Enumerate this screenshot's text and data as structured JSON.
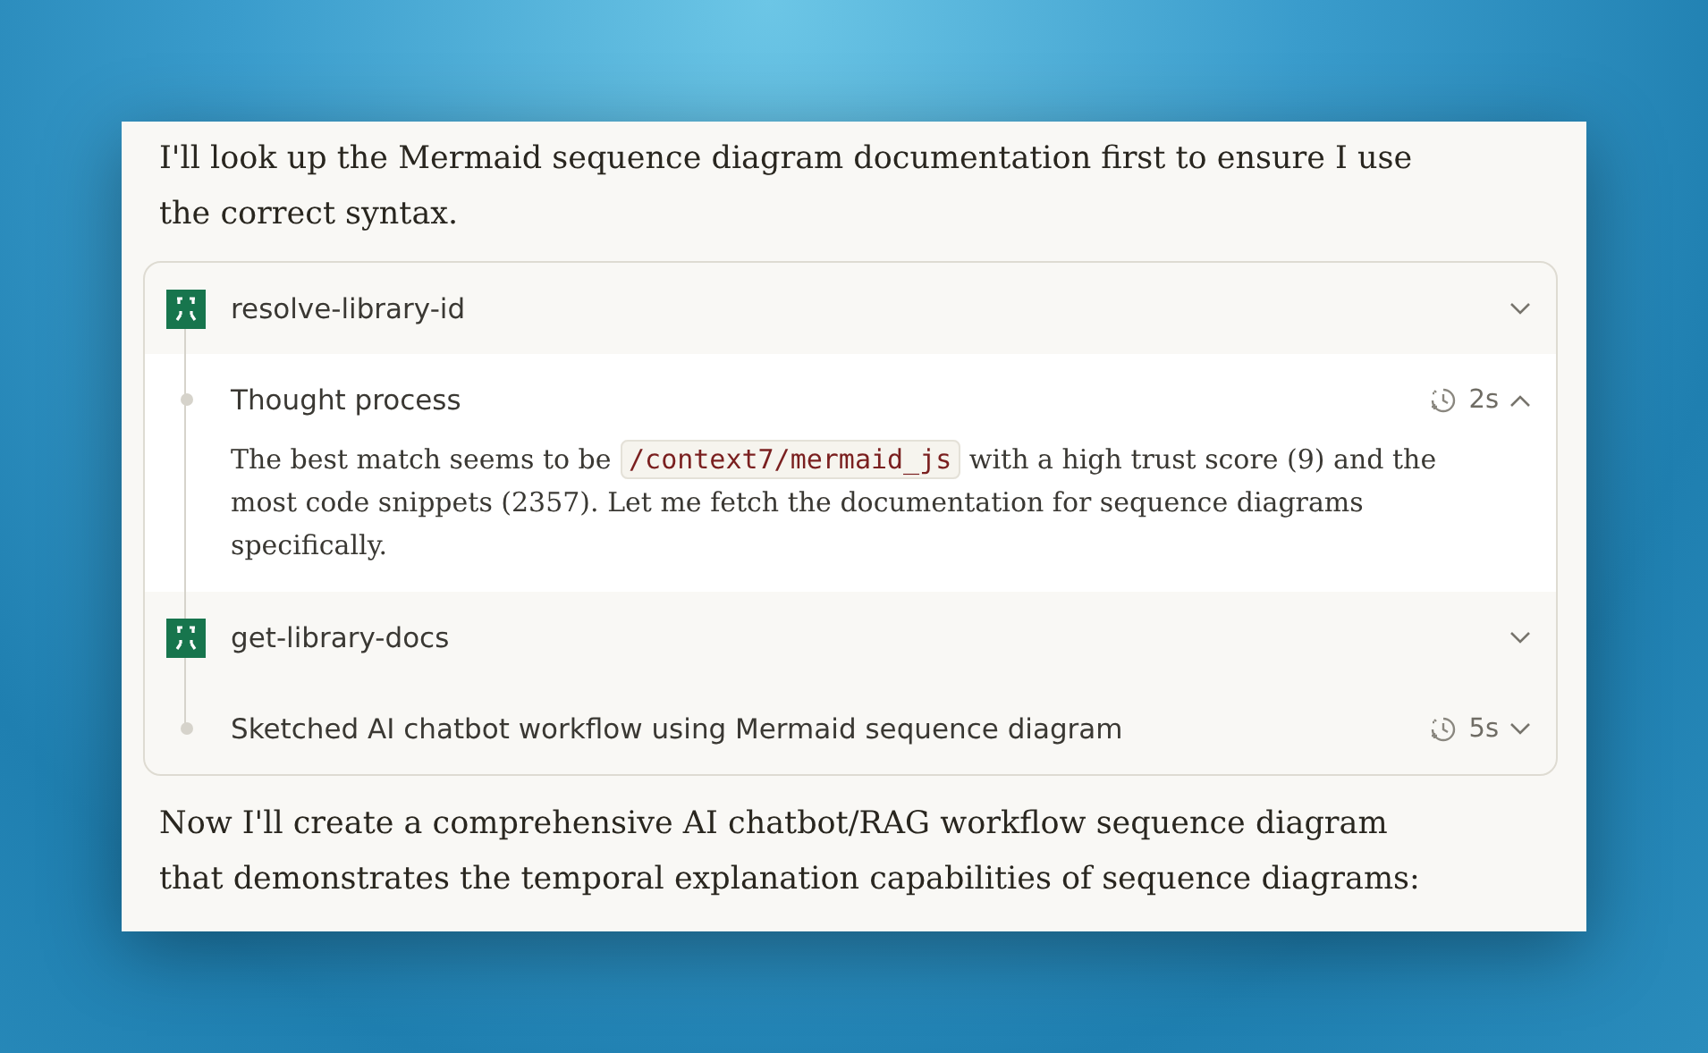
{
  "intro": "I'll look up the Mermaid sequence diagram documentation first to ensure I use the correct syntax.",
  "steps": [
    {
      "kind": "tool",
      "label": "resolve-library-id",
      "expanded": false
    },
    {
      "kind": "thought",
      "label": "Thought process",
      "duration": "2s",
      "expanded": true,
      "body": [
        {
          "kind": "text",
          "text": "The best match seems to be "
        },
        {
          "kind": "code",
          "text": "/context7/mermaid_js"
        },
        {
          "kind": "text",
          "text": " with a high trust score (9) and the most code snippets (2357). Let me fetch the documentation for sequence diagrams specifically."
        }
      ]
    },
    {
      "kind": "tool",
      "label": "get-library-docs",
      "expanded": false
    },
    {
      "kind": "thought",
      "label": "Sketched AI chatbot workflow using Mermaid sequence diagram",
      "duration": "5s",
      "expanded": false
    }
  ],
  "outro": "Now I'll create a comprehensive AI chatbot/RAG workflow sequence diagram that demonstrates the temporal explanation capabilities of sequence diagrams:"
}
